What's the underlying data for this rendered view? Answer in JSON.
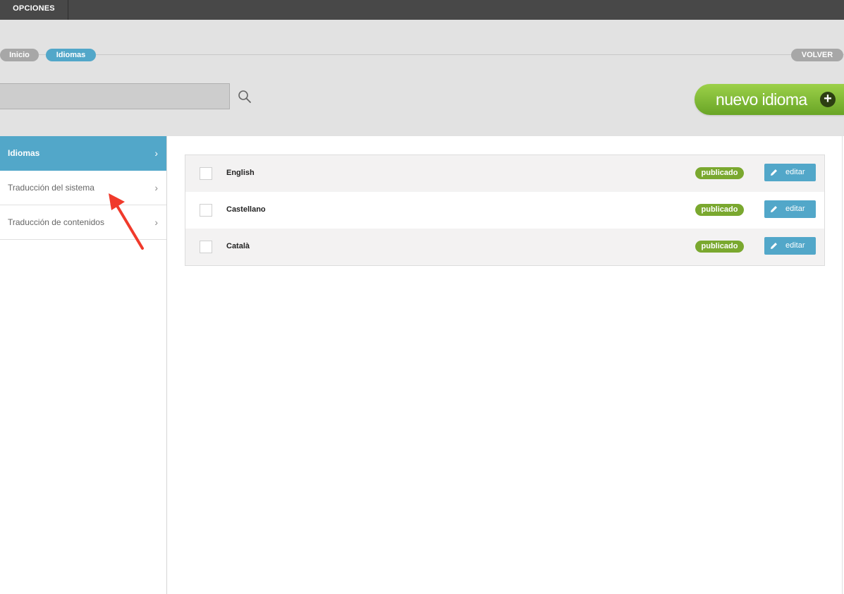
{
  "topbar": {
    "tab_label": "OPCIONES"
  },
  "breadcrumb": {
    "home": "Inicio",
    "current": "Idiomas",
    "back": "VOLVER"
  },
  "search": {
    "value": "",
    "placeholder": ""
  },
  "new_button": {
    "label": "nuevo idioma",
    "icon": "+"
  },
  "sidebar": {
    "items": [
      {
        "label": "Idiomas",
        "chevron": "›"
      },
      {
        "label": "Traducción del sistema",
        "chevron": "›"
      },
      {
        "label": "Traducción de contenidos",
        "chevron": "›"
      }
    ]
  },
  "languages": [
    {
      "name": "English",
      "status": "publicado",
      "action": "editar"
    },
    {
      "name": "Castellano",
      "status": "publicado",
      "action": "editar"
    },
    {
      "name": "Català",
      "status": "publicado",
      "action": "editar"
    }
  ],
  "colors": {
    "accent": "#52a7c9",
    "success": "#7aa82f",
    "topbar": "#484848",
    "annotation": "#f03a2b"
  },
  "icons": {
    "search": "search-icon",
    "plus": "plus-icon",
    "edit": "pencil-icon",
    "chevron": "chevron-right-icon",
    "annotation": "arrow-annotation"
  }
}
